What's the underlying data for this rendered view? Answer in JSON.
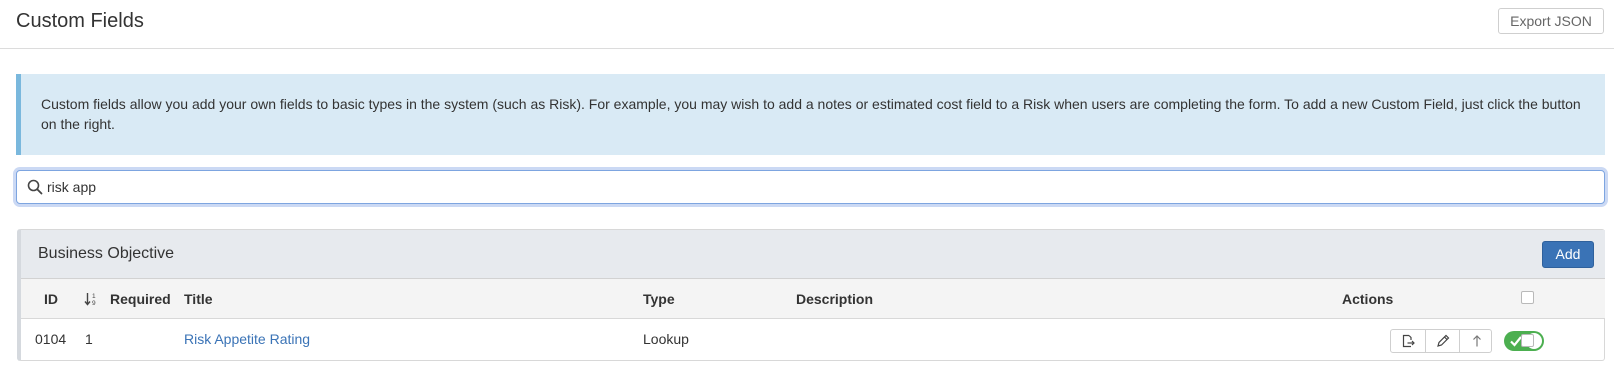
{
  "header": {
    "title": "Custom Fields",
    "export_label": "Export JSON"
  },
  "info": {
    "text": "Custom fields allow you add your own fields to basic types in the system (such as Risk). For example, you may wish to add a notes or estimated cost field to a Risk when users are completing the form. To add a new Custom Field, just click the button on the right."
  },
  "search": {
    "value": "risk app",
    "icon": "search-icon"
  },
  "panel": {
    "title": "Business Objective",
    "add_label": "Add",
    "columns": {
      "id": "ID",
      "required": "Required",
      "title": "Title",
      "type": "Type",
      "description": "Description",
      "actions": "Actions"
    },
    "rows": [
      {
        "id": "0104",
        "order": "1",
        "required": "",
        "title": "Risk Appetite Rating",
        "type": "Lookup",
        "description": "",
        "enabled": true,
        "checked": false
      }
    ],
    "action_icons": [
      "export-icon",
      "edit-icon",
      "move-up-icon"
    ]
  },
  "colors": {
    "accent": "#3a73b6",
    "info_bg": "#d9eaf5",
    "info_border": "#7ab8dd",
    "toggle_on": "#4caf50"
  }
}
